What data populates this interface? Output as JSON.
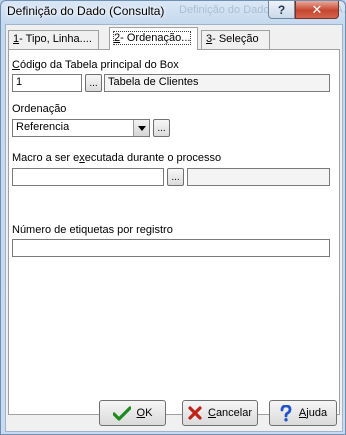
{
  "window": {
    "title": "Definição do Dado (Consulta)",
    "ghost_title": "Definição do Dado... Origem do A...",
    "help_glyph": "?",
    "close_glyph": "✕"
  },
  "tabs": [
    {
      "hotkey": "1",
      "rest": "- Tipo, Linha...."
    },
    {
      "hotkey": "2",
      "rest": "- Ordenação..."
    },
    {
      "hotkey": "3",
      "rest": "- Seleção"
    }
  ],
  "form": {
    "codigo_label_hotkey": "C",
    "codigo_label_rest": "ódigo da Tabela principal do Box",
    "codigo_value": "1",
    "codigo_button": "...",
    "tabela_nome": "Tabela de Clientes",
    "ordenacao_label": "Ordenação",
    "ordenacao_value": "Referencia",
    "ordenacao_button": "...",
    "macro_label_pre": "Macro a ser e",
    "macro_label_hotkey": "x",
    "macro_label_post": "ecutada durante o processo",
    "macro_value": "",
    "macro_button": "...",
    "macro_desc": "",
    "etiquetas_label": "Número de etiquetas por registro",
    "etiquetas_value": ""
  },
  "buttons": {
    "ok_hotkey": "O",
    "ok_rest": "K",
    "cancel_hotkey": "C",
    "cancel_rest": "ancelar",
    "help_hotkey": "A",
    "help_rest": "juda"
  },
  "icons": {
    "ok": "check-icon",
    "cancel": "x-icon",
    "help": "question-mark-icon",
    "combo": "dropdown-arrow-icon"
  },
  "colors": {
    "ok_icon": "#1d8a1d",
    "cancel_icon": "#c0221a",
    "help_icon": "#1f55c8"
  }
}
